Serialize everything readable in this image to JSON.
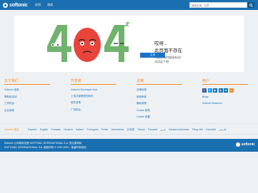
{
  "header": {
    "brand": "softonic",
    "nav": [
      "应用",
      "游戏"
    ],
    "search_placeholder": "搜索应用、文章"
  },
  "error": {
    "code": "404",
    "title": "哎呀...",
    "subtitle": "此页面不存在",
    "question": "可能使用的链接有误？",
    "hint": "试试这个吧:",
    "button": "主页",
    "colors": {
      "four": "#6fb36d",
      "zero": "#e8443a",
      "accent": "#1a73c8"
    }
  },
  "footer": {
    "columns": [
      {
        "heading": "关于我们",
        "links": [
          "Softonic 信息",
          "帮助和支持",
          "工作机会",
          "企业新闻"
        ]
      },
      {
        "heading": "开发者",
        "links": [
          "Softonic Developer Hub",
          "上传并管理您的软件",
          "软件政策",
          "广告机会"
        ]
      },
      {
        "heading": "法律",
        "links": [
          "法律信息",
          "使用条款",
          "隐私政策",
          "Cookie 政策",
          "Cookie 设置"
        ]
      },
      {
        "heading": "用户",
        "links": [
          "Blogs",
          "Softonic Business"
        ]
      }
    ],
    "social_icons": [
      {
        "name": "facebook-icon",
        "glyph": "f",
        "color": "#3b5998"
      },
      {
        "name": "twitter-icon",
        "glyph": "t",
        "color": "#1da1f2"
      },
      {
        "name": "youtube-icon",
        "glyph": "▶",
        "color": "#1a6fb0"
      },
      {
        "name": "instagram-icon",
        "glyph": "◎",
        "color": "#1a6fb0"
      },
      {
        "name": "linkedin-icon",
        "glyph": "in",
        "color": "#0e76a8"
      },
      {
        "name": "rss-icon",
        "glyph": "≈",
        "color": "#f28c28"
      }
    ]
  },
  "languages": {
    "label": "Softonic 语言",
    "list": [
      "Español",
      "English",
      "Français",
      "Deutsch",
      "Italiano",
      "Português",
      "Polski",
      "Nederlands",
      "日本語",
      "Türkçe",
      "Русский",
      "عربي",
      "Bahasa Indonesia",
      "Tiếng Việt",
      "Kiswahili",
      "فارسی"
    ]
  },
  "legal": {
    "line1": "Softonic 公司和标志是 SOFTONIC INTERNATIONAL S.A. 的注册商标",
    "line2": "SOFTONIC INTERNATIONAL S.A. 版权所有 © 1997-2020 - 保留所有权利"
  }
}
